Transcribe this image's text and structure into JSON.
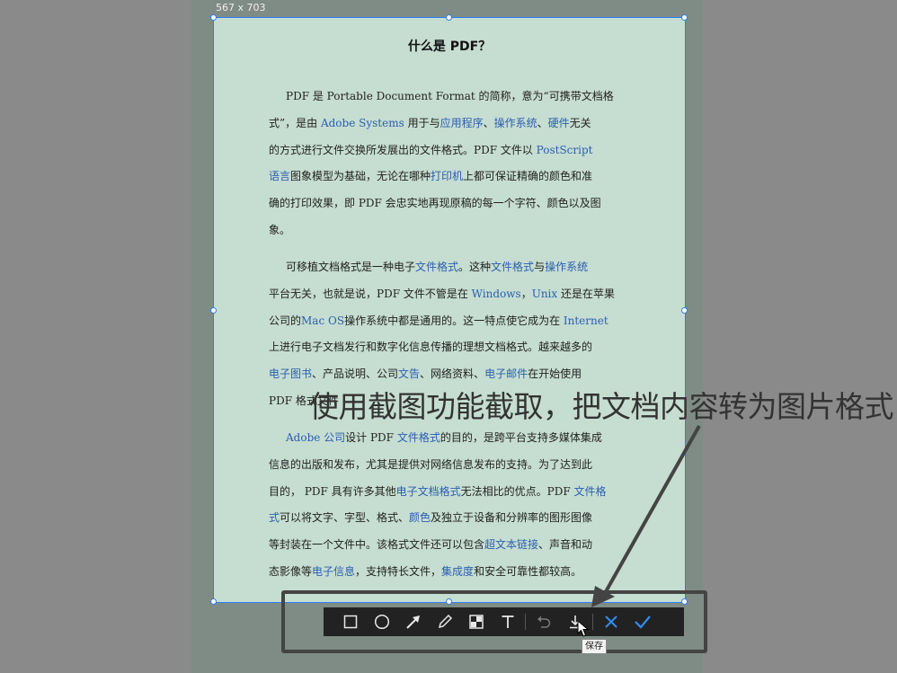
{
  "screenshot": {
    "size_label": "567 x 703",
    "selection_color": "#2f7df4",
    "page_color": "#c6ddd1"
  },
  "document": {
    "title": "什么是 PDF？",
    "paragraphs": [
      {
        "lines": [
          [
            {
              "t": "PDF 是 Portable Document Format 的简称，意为“可携带文档格"
            }
          ],
          [
            {
              "t": "式”，是由 "
            },
            {
              "t": "Adobe  Systems",
              "l": 1
            },
            {
              "t": " 用于与"
            },
            {
              "t": "应用程序",
              "l": 1
            },
            {
              "t": "、"
            },
            {
              "t": "操作系统",
              "l": 1
            },
            {
              "t": "、"
            },
            {
              "t": "硬件",
              "l": 1
            },
            {
              "t": "无关"
            }
          ],
          [
            {
              "t": "的方式进行文件交换所发展出的文件格式。PDF 文件以 "
            },
            {
              "t": "PostScript",
              "l": 1
            }
          ],
          [
            {
              "t": "语言",
              "l": 1
            },
            {
              "t": "图象模型为基础，无论在哪种"
            },
            {
              "t": "打印机",
              "l": 1
            },
            {
              "t": "上都可保证精确的颜色和准"
            }
          ],
          [
            {
              "t": "确的打印效果，即 PDF 会忠实地再现原稿的每一个字符、颜色以及图"
            }
          ],
          [
            {
              "t": "象。"
            }
          ]
        ]
      },
      {
        "lines": [
          [
            {
              "t": "可移植文档格式是一种电子"
            },
            {
              "t": "文件格式",
              "l": 1
            },
            {
              "t": "。这种"
            },
            {
              "t": "文件格式",
              "l": 1
            },
            {
              "t": "与"
            },
            {
              "t": "操作系统",
              "l": 1
            }
          ],
          [
            {
              "t": "平台无关，也就是说，PDF 文件不管是在 "
            },
            {
              "t": "Windows",
              "l": 1
            },
            {
              "t": "，"
            },
            {
              "t": "Unix",
              "l": 1
            },
            {
              "t": " 还是在苹果"
            }
          ],
          [
            {
              "t": "公司的"
            },
            {
              "t": "Mac OS",
              "l": 1
            },
            {
              "t": "操作系统中都是通用的。这一特点使它成为在 "
            },
            {
              "t": "Internet",
              "l": 1
            }
          ],
          [
            {
              "t": "上进行电子文档发行和数字化信息传播的理想文档格式。越来越多的"
            }
          ],
          [
            {
              "t": "电子图书",
              "l": 1
            },
            {
              "t": "、产品说明、公司"
            },
            {
              "t": "文告",
              "l": 1
            },
            {
              "t": "、网络资料、"
            },
            {
              "t": "电子邮件",
              "l": 1
            },
            {
              "t": "在开始使用"
            }
          ],
          [
            {
              "t": "PDF 格式文件"
            }
          ]
        ]
      },
      {
        "lines": [
          [
            {
              "t": "Adobe 公司",
              "l": 1
            },
            {
              "t": "设计 PDF "
            },
            {
              "t": "文件格式",
              "l": 1
            },
            {
              "t": "的目的，是跨平台支持多媒体集成"
            }
          ],
          [
            {
              "t": "信息的出版和发布，尤其是提供对网络信息发布的支持。为了达到此"
            }
          ],
          [
            {
              "t": "目的， PDF 具有许多其他"
            },
            {
              "t": "电子文档格式",
              "l": 1
            },
            {
              "t": "无法相比的优点。PDF "
            },
            {
              "t": "文件格",
              "l": 1
            }
          ],
          [
            {
              "t": "式",
              "l": 1
            },
            {
              "t": "可以将文字、字型、格式、"
            },
            {
              "t": "颜色",
              "l": 1
            },
            {
              "t": "及独立于设备和分辨率的图形图像"
            }
          ],
          [
            {
              "t": "等封装在一个文件中。该格式文件还可以包含"
            },
            {
              "t": "超文本链接",
              "l": 1
            },
            {
              "t": "、声音和动"
            }
          ],
          [
            {
              "t": "态影像等"
            },
            {
              "t": "电子信息",
              "l": 1
            },
            {
              "t": "，支持特长文件，"
            },
            {
              "t": "集成度",
              "l": 1
            },
            {
              "t": "和安全可靠性都较高。"
            }
          ]
        ]
      }
    ]
  },
  "annotation": {
    "caption": "使用截图功能截取，把文档内容转为图片格式",
    "arrow_color": "#444444"
  },
  "toolbar": {
    "tools": [
      {
        "name": "rectangle-tool",
        "icon": "rectangle-icon"
      },
      {
        "name": "ellipse-tool",
        "icon": "circle-icon"
      },
      {
        "name": "arrow-tool",
        "icon": "arrow-icon"
      },
      {
        "name": "pencil-tool",
        "icon": "pencil-icon"
      },
      {
        "name": "mosaic-tool",
        "icon": "mosaic-icon"
      },
      {
        "name": "text-tool",
        "icon": "text-icon"
      },
      {
        "name": "undo-button",
        "icon": "undo-icon"
      },
      {
        "name": "save-button",
        "icon": "download-icon"
      },
      {
        "name": "cancel-button",
        "icon": "close-icon"
      },
      {
        "name": "confirm-button",
        "icon": "check-icon"
      }
    ],
    "save_tooltip": "保存",
    "accent_color": "#2f8df5"
  }
}
